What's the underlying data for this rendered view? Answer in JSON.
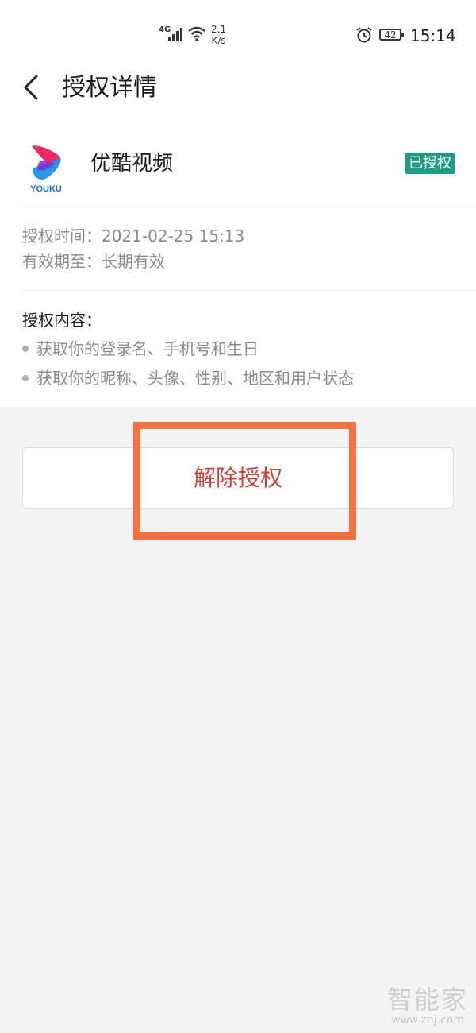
{
  "status_bar": {
    "network": "4G",
    "speed_value": "2.1",
    "speed_unit": "K/s",
    "battery": "42",
    "time": "15:14",
    "icons": [
      "signal-icon",
      "wifi-icon",
      "alarm-icon",
      "battery-icon"
    ]
  },
  "header": {
    "title": "授权详情"
  },
  "app": {
    "logo_text": "YOUKU",
    "name": "优酷视频",
    "status_badge": "已授权",
    "badge_color": "#1f9c88"
  },
  "info": {
    "auth_time_label": "授权时间：",
    "auth_time_value": "2021-02-25 15:13",
    "valid_until_label": "有效期至：",
    "valid_until_value": "长期有效"
  },
  "content": {
    "title": "授权内容：",
    "items": [
      "获取你的登录名、手机号和生日",
      "获取你的昵称、头像、性别、地区和用户状态"
    ]
  },
  "action": {
    "revoke_label": "解除授权",
    "revoke_color": "#d2403a",
    "highlight_color": "#f47141"
  },
  "watermark": {
    "text": "智能家",
    "url": "www.znj.com"
  }
}
